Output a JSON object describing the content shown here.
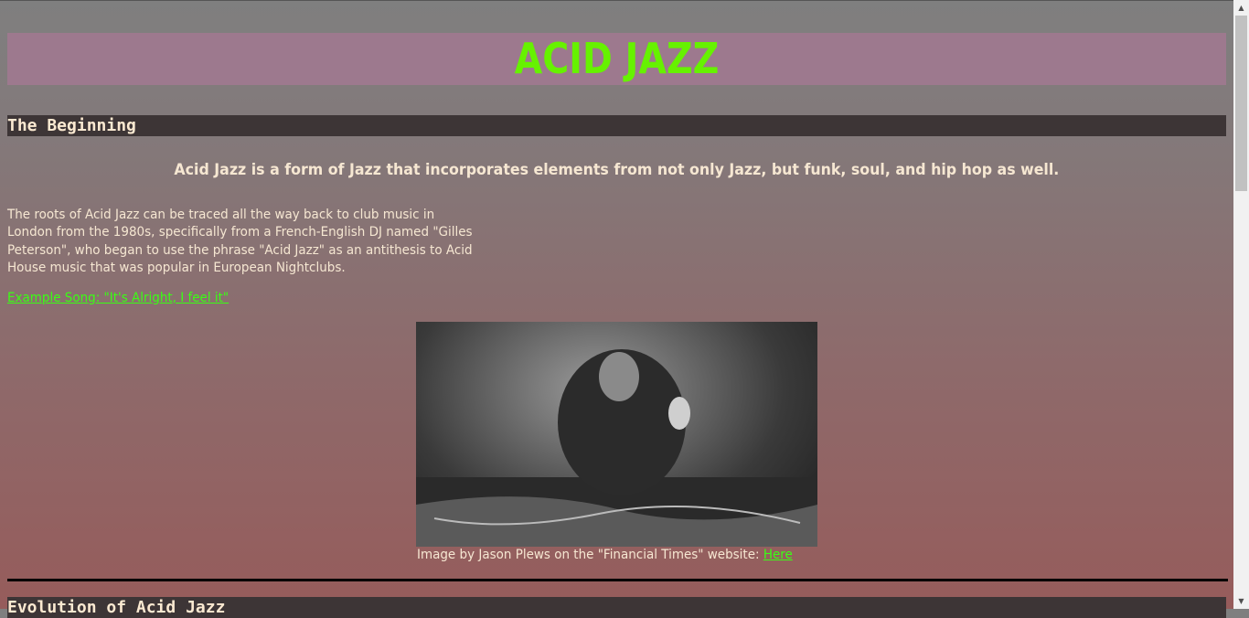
{
  "title": "ACID JAZZ",
  "sections": [
    {
      "heading": "The Beginning",
      "lead": "Acid Jazz is a form of Jazz that incorporates elements from not only Jazz, but funk, soul, and hip hop as well.",
      "paragraph": "The roots of Acid Jazz can be traced all the way back to club music in London from the 1980s, specifically from a French-English DJ named \"Gilles Peterson\", who began to use the phrase \"Acid Jazz\" as an antithesis to Acid House music that was popular in European Nightclubs.",
      "song_link": "Example Song: \"It's Alright, I feel it\"",
      "caption": "Image by Jason Plews on the \"Financial Times\" website: ",
      "caption_link": "Here"
    },
    {
      "heading": "Evolution of Acid Jazz"
    }
  ],
  "colors": {
    "title": "#66f200",
    "link": "#39ff14",
    "heading_bar": "#3d3536",
    "banner": "#9d798e"
  }
}
